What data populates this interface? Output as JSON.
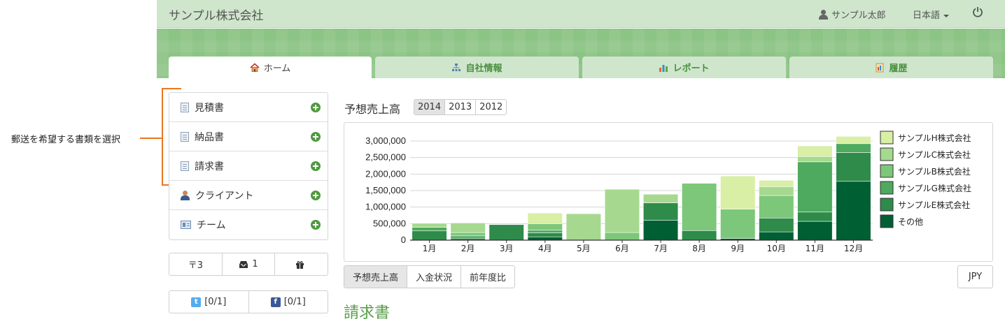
{
  "annotation": {
    "text": "郵送を希望する書類を選択"
  },
  "header": {
    "app_title": "サンプル株式会社",
    "user_name": "サンプル太郎",
    "language": "日本語",
    "user_icon": "user-icon",
    "power_icon": "power-icon"
  },
  "tabs": [
    {
      "label": "ホーム",
      "icon": "home-icon",
      "active": true
    },
    {
      "label": "自社情報",
      "icon": "org-chart-icon",
      "active": false
    },
    {
      "label": "レポート",
      "icon": "bar-chart-icon",
      "active": false
    },
    {
      "label": "履歴",
      "icon": "history-icon",
      "active": false
    }
  ],
  "sidebar": {
    "items": [
      {
        "label": "見積書",
        "icon": "document-icon"
      },
      {
        "label": "納品書",
        "icon": "document-icon"
      },
      {
        "label": "請求書",
        "icon": "invoice-icon"
      },
      {
        "label": "クライアント",
        "icon": "person-icon"
      },
      {
        "label": "チーム",
        "icon": "team-icon"
      }
    ]
  },
  "counts": [
    {
      "icon": "postal-icon",
      "value": "〒3"
    },
    {
      "icon": "inbox-icon",
      "value": "1"
    },
    {
      "icon": "gift-icon",
      "value": ""
    }
  ],
  "social": [
    {
      "icon": "twitter-icon",
      "value": "[0/1]"
    },
    {
      "icon": "facebook-icon",
      "value": "[0/1]"
    }
  ],
  "chart_section": {
    "title": "予想売上高",
    "years": [
      "2014",
      "2013",
      "2012"
    ],
    "selected_year": "2014",
    "bottom_tabs": [
      "予想売上高",
      "入金状況",
      "前年度比"
    ],
    "selected_bottom_tab": "予想売上高",
    "currency": "JPY"
  },
  "section_heading": "請求書",
  "colors": {
    "accent_green": "#4e9a3f",
    "header_bg": "#cfe6cc",
    "banner_bg": "#8cc485",
    "annotation_orange": "#e87722"
  },
  "chart_data": {
    "type": "bar",
    "stacked": true,
    "categories": [
      "1月",
      "2月",
      "3月",
      "4月",
      "5月",
      "6月",
      "7月",
      "8月",
      "9月",
      "10月",
      "11月",
      "12月"
    ],
    "ylim": [
      0,
      3000000
    ],
    "yticks": [
      "0",
      "500,000",
      "1,000,000",
      "1,500,000",
      "2,000,000",
      "2,500,000",
      "3,000,000"
    ],
    "ytick_values": [
      0,
      500000,
      1000000,
      1500000,
      2000000,
      2500000,
      3000000
    ],
    "legend_position": "right",
    "grid": true,
    "series": [
      {
        "name": "その他",
        "color": "#005f33",
        "values": [
          0,
          0,
          0,
          100000,
          0,
          0,
          600000,
          0,
          50000,
          250000,
          570000,
          1780000
        ]
      },
      {
        "name": "サンプルE株式会社",
        "color": "#2e8b4a",
        "values": [
          280000,
          60000,
          470000,
          120000,
          0,
          0,
          530000,
          290000,
          0,
          420000,
          280000,
          870000
        ]
      },
      {
        "name": "サンプルG株式会社",
        "color": "#4daa5e",
        "values": [
          110000,
          70000,
          0,
          80000,
          0,
          0,
          0,
          0,
          0,
          0,
          1520000,
          270000
        ]
      },
      {
        "name": "サンプルB株式会社",
        "color": "#7cc77a",
        "values": [
          0,
          100000,
          0,
          200000,
          0,
          230000,
          0,
          1430000,
          890000,
          680000,
          0,
          0
        ]
      },
      {
        "name": "サンプルC株式会社",
        "color": "#a6d98f",
        "values": [
          120000,
          290000,
          0,
          0,
          800000,
          1310000,
          260000,
          0,
          0,
          270000,
          160000,
          0
        ]
      },
      {
        "name": "サンプルH株式会社",
        "color": "#d8efa5",
        "values": [
          0,
          0,
          0,
          320000,
          0,
          0,
          0,
          0,
          1000000,
          190000,
          320000,
          220000
        ]
      }
    ]
  }
}
